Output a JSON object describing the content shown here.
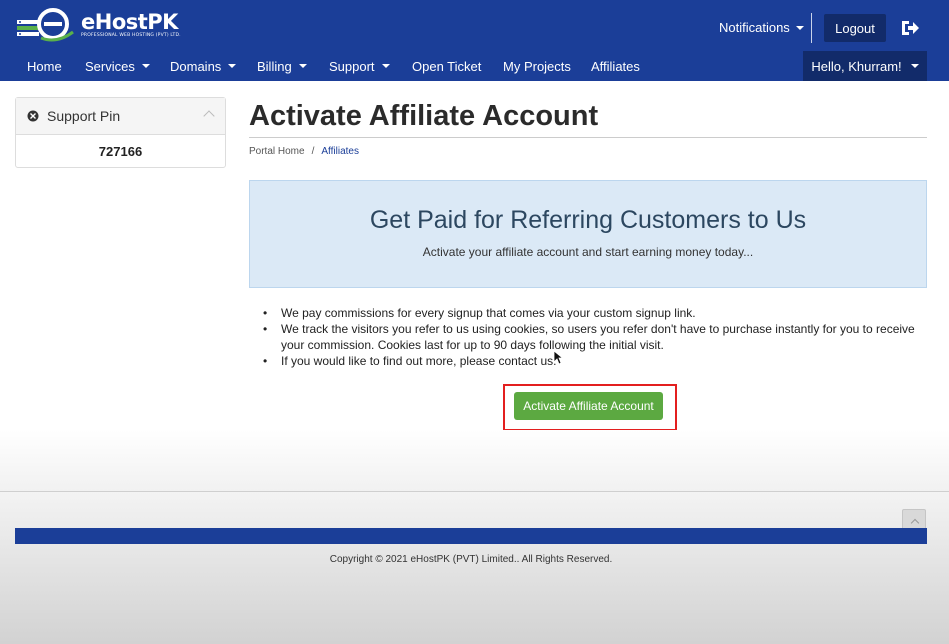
{
  "header": {
    "logo_name": "eHostPK",
    "logo_tagline": "PROFESSIONAL WEB HOSTING (PVT) LTD.",
    "notifications_label": "Notifications",
    "logout_label": "Logout",
    "brand_color": "#1b3e98"
  },
  "nav": {
    "items": [
      {
        "label": "Home"
      },
      {
        "label": "Services"
      },
      {
        "label": "Domains"
      },
      {
        "label": "Billing"
      },
      {
        "label": "Support"
      },
      {
        "label": "Open Ticket"
      },
      {
        "label": "My Projects"
      },
      {
        "label": "Affiliates"
      }
    ],
    "user_greeting": "Hello, Khurram!"
  },
  "sidebar": {
    "panel_title": "Support Pin",
    "pin": "727166"
  },
  "main": {
    "title": "Activate Affiliate Account",
    "breadcrumb": [
      "Portal Home",
      "/",
      "Affiliates"
    ],
    "hero_title": "Get Paid for Referring Customers to Us",
    "hero_subtitle": "Activate your affiliate account and start earning money today...",
    "bullets": [
      "We pay commissions for every signup that comes via your custom signup link.",
      "We track the visitors you refer to us using cookies, so users you refer don't have to purchase instantly for you to receive your commission. Cookies last for up to 90 days following the initial visit.",
      "If you would like to find out more, please contact us."
    ],
    "activate_button": "Activate Affiliate Account"
  },
  "footer": {
    "copyright": "Copyright © 2021 eHostPK (PVT) Limited.. All Rights Reserved."
  }
}
